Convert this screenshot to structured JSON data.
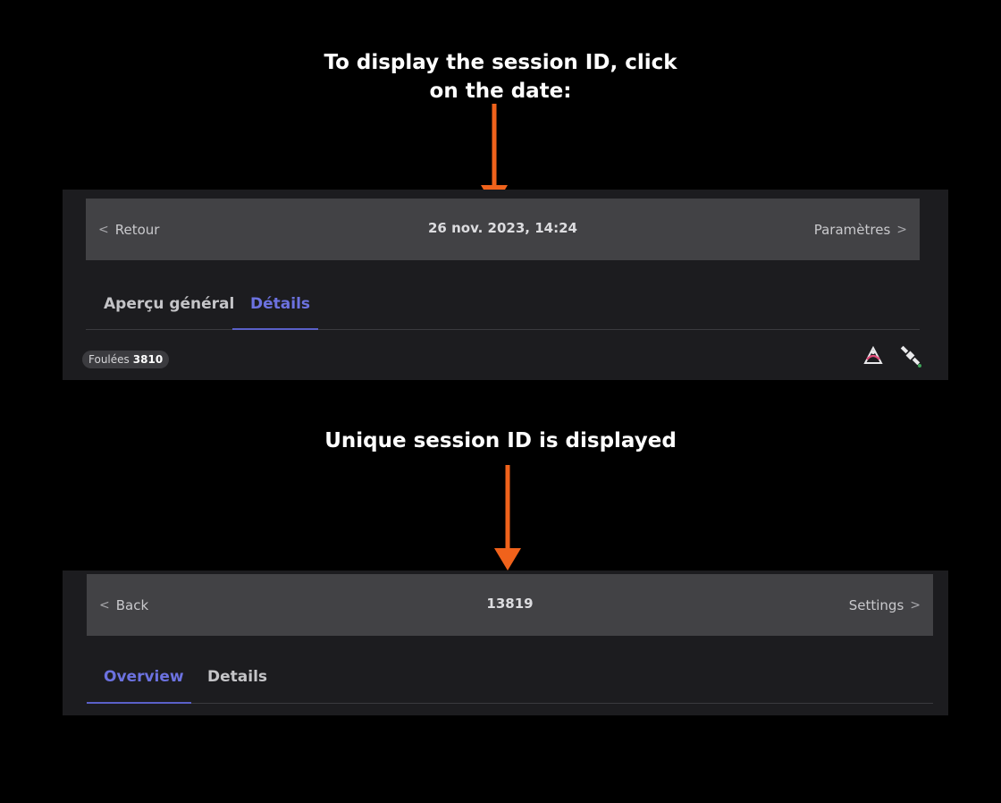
{
  "captions": {
    "top_line1": "To display the session ID, click",
    "top_line2": "on the date:",
    "middle": "Unique session ID is displayed"
  },
  "panel_before": {
    "nav": {
      "back_label": "Retour",
      "title": "26 nov. 2023, 14:24",
      "settings_label": "Paramètres"
    },
    "tabs": [
      {
        "label": "Aperçu général",
        "active": false
      },
      {
        "label": "Détails",
        "active": true
      }
    ],
    "badge": {
      "label": "Foulées",
      "value": "3810"
    },
    "icons": [
      "pace-icon",
      "satellite-icon"
    ]
  },
  "panel_after": {
    "nav": {
      "back_label": "Back",
      "title": "13819",
      "settings_label": "Settings"
    },
    "tabs": [
      {
        "label": "Overview",
        "active": true
      },
      {
        "label": "Details",
        "active": false
      }
    ]
  },
  "colors": {
    "accent_arrow": "#f0621b",
    "active_tab": "#6c72e0",
    "navbar_bg": "#424245",
    "panel_bg": "#1c1c1f"
  }
}
